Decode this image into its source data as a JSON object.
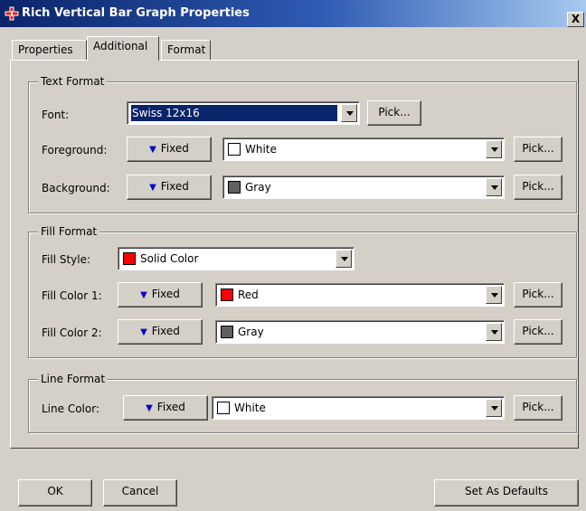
{
  "window": {
    "title": "Rich Vertical Bar Graph Properties",
    "close_label": "X"
  },
  "tabs": [
    {
      "label": "Properties"
    },
    {
      "label": "Additional"
    },
    {
      "label": "Format"
    }
  ],
  "text_format": {
    "legend": "Text Format",
    "font_label": "Font:",
    "font_value": "Swiss 12x16",
    "font_pick": "Pick...",
    "foreground_label": "Foreground:",
    "foreground_mode": "Fixed",
    "foreground_value": "White",
    "foreground_color": "#ffffff",
    "foreground_pick": "Pick...",
    "background_label": "Background:",
    "background_mode": "Fixed",
    "background_value": "Gray",
    "background_color": "#606060",
    "background_pick": "Pick..."
  },
  "fill_format": {
    "legend": "Fill Format",
    "style_label": "Fill Style:",
    "style_value": "Solid Color",
    "style_color": "#ff0000",
    "color1_label": "Fill Color 1:",
    "color1_mode": "Fixed",
    "color1_value": "Red",
    "color1_color": "#ff0000",
    "color1_pick": "Pick...",
    "color2_label": "Fill Color 2:",
    "color2_mode": "Fixed",
    "color2_value": "Gray",
    "color2_color": "#606060",
    "color2_pick": "Pick..."
  },
  "line_format": {
    "legend": "Line Format",
    "color_label": "Line Color:",
    "color_mode": "Fixed",
    "color_value": "White",
    "color_color": "#ffffff",
    "color_pick": "Pick..."
  },
  "footer": {
    "ok": "OK",
    "cancel": "Cancel",
    "set_defaults": "Set As Defaults"
  }
}
